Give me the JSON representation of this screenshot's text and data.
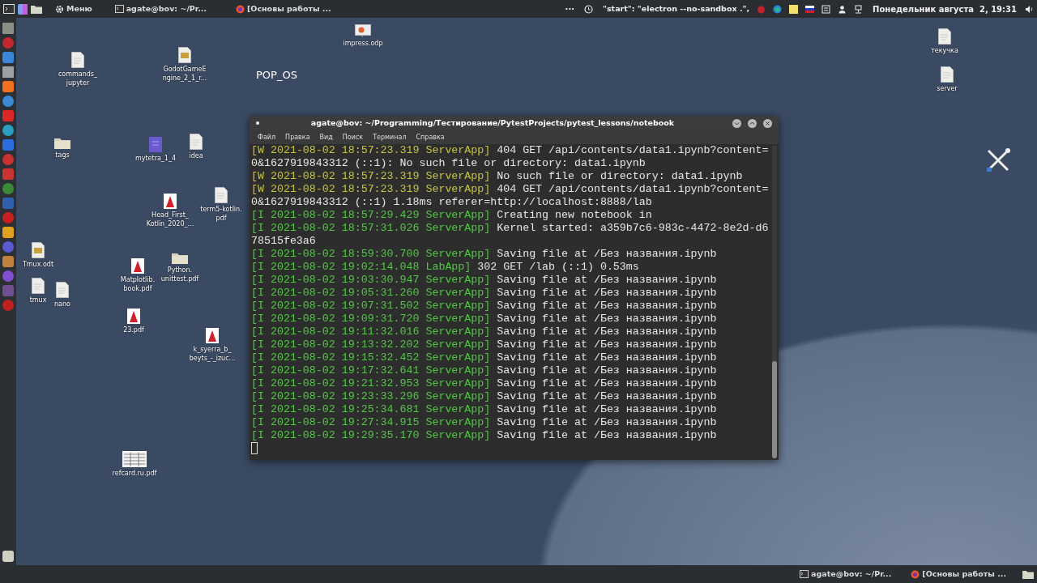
{
  "top_panel": {
    "menu_label": "Меню",
    "tasks": [
      {
        "kind": "terminal",
        "label": "agate@bov: ~/Pr..."
      },
      {
        "kind": "browser",
        "label": "[Основы работы ..."
      }
    ],
    "overflow": "···",
    "status_text": "\"start\": \"electron --no-sandbox .\",",
    "clock": "Понедельник августа  2, 19:31"
  },
  "desktop": {
    "os_label": "POP_OS",
    "icons": [
      {
        "kind": "doc",
        "label": [
          "commands_",
          "jupyter"
        ]
      },
      {
        "kind": "image",
        "label": [
          "GodotGameE",
          "ngine_2_1_r..."
        ]
      },
      {
        "kind": "slides",
        "label": [
          "impress.odp"
        ]
      },
      {
        "kind": "doc",
        "label": [
          "текучка"
        ]
      },
      {
        "kind": "doc",
        "label": [
          "server"
        ]
      },
      {
        "kind": "folder",
        "label": [
          "tags"
        ]
      },
      {
        "kind": "app",
        "label": [
          "mytetra_1_4"
        ]
      },
      {
        "kind": "doc",
        "label": [
          "idea"
        ]
      },
      {
        "kind": "pdf",
        "label": [
          "Head_First_",
          "Kotlin_2020_..."
        ]
      },
      {
        "kind": "doc",
        "label": [
          "term5-kotlin.",
          "pdf"
        ]
      },
      {
        "kind": "image",
        "label": [
          "Tmux.odt"
        ]
      },
      {
        "kind": "doc",
        "label": [
          "tmux"
        ]
      },
      {
        "kind": "doc",
        "label": [
          "nano"
        ]
      },
      {
        "kind": "pdf",
        "label": [
          "Matplotlib.",
          "book.pdf"
        ]
      },
      {
        "kind": "folder",
        "label": [
          "Python.",
          "unittest.pdf"
        ]
      },
      {
        "kind": "pdf",
        "label": [
          "23.pdf"
        ]
      },
      {
        "kind": "pdf",
        "label": [
          "k_syerra_b_",
          "beyts_-_izuc..."
        ]
      },
      {
        "kind": "table",
        "label": [
          "refcard.ru.pdf"
        ]
      }
    ]
  },
  "terminal": {
    "title": "agate@bov: ~/Programming/Тестирование/PytestProjects/pytest_lessons/notebook",
    "menu": [
      "Файл",
      "Правка",
      "Вид",
      "Поиск",
      "Терминал",
      "Справка"
    ],
    "lines": [
      {
        "kind": "warning",
        "prefix": "[W 2021-08-02 18:57:23.319 ServerApp]",
        "message": "404 GET /api/contents/data1.ipynb?content=0&1627919843312 (::1): No such file or directory: data1.ipynb"
      },
      {
        "kind": "warning",
        "prefix": "[W 2021-08-02 18:57:23.319 ServerApp]",
        "message": "No such file or directory: data1.ipynb"
      },
      {
        "kind": "warning",
        "prefix": "[W 2021-08-02 18:57:23.319 ServerApp]",
        "message": "404 GET /api/contents/data1.ipynb?content=0&1627919843312 (::1) 1.18ms referer=http://localhost:8888/lab"
      },
      {
        "kind": "info",
        "prefix": "[I 2021-08-02 18:57:29.429 ServerApp]",
        "message": "Creating new notebook in"
      },
      {
        "kind": "info",
        "prefix": "[I 2021-08-02 18:57:31.026 ServerApp]",
        "message": "Kernel started: a359b7c6-983c-4472-8e2d-d678515fe3a6"
      },
      {
        "kind": "info",
        "prefix": "[I 2021-08-02 18:59:30.700 ServerApp]",
        "message": "Saving file at /Без названия.ipynb"
      },
      {
        "kind": "info",
        "prefix": "[I 2021-08-02 19:02:14.048 LabApp]",
        "message": "302 GET /lab (::1) 0.53ms"
      },
      {
        "kind": "info",
        "prefix": "[I 2021-08-02 19:03:30.947 ServerApp]",
        "message": "Saving file at /Без названия.ipynb"
      },
      {
        "kind": "info",
        "prefix": "[I 2021-08-02 19:05:31.260 ServerApp]",
        "message": "Saving file at /Без названия.ipynb"
      },
      {
        "kind": "info",
        "prefix": "[I 2021-08-02 19:07:31.502 ServerApp]",
        "message": "Saving file at /Без названия.ipynb"
      },
      {
        "kind": "info",
        "prefix": "[I 2021-08-02 19:09:31.720 ServerApp]",
        "message": "Saving file at /Без названия.ipynb"
      },
      {
        "kind": "info",
        "prefix": "[I 2021-08-02 19:11:32.016 ServerApp]",
        "message": "Saving file at /Без названия.ipynb"
      },
      {
        "kind": "info",
        "prefix": "[I 2021-08-02 19:13:32.202 ServerApp]",
        "message": "Saving file at /Без названия.ipynb"
      },
      {
        "kind": "info",
        "prefix": "[I 2021-08-02 19:15:32.452 ServerApp]",
        "message": "Saving file at /Без названия.ipynb"
      },
      {
        "kind": "info",
        "prefix": "[I 2021-08-02 19:17:32.641 ServerApp]",
        "message": "Saving file at /Без названия.ipynb"
      },
      {
        "kind": "info",
        "prefix": "[I 2021-08-02 19:21:32.953 ServerApp]",
        "message": "Saving file at /Без названия.ipynb"
      },
      {
        "kind": "info",
        "prefix": "[I 2021-08-02 19:23:33.296 ServerApp]",
        "message": "Saving file at /Без названия.ipynb"
      },
      {
        "kind": "info",
        "prefix": "[I 2021-08-02 19:25:34.681 ServerApp]",
        "message": "Saving file at /Без названия.ipynb"
      },
      {
        "kind": "info",
        "prefix": "[I 2021-08-02 19:27:34.915 ServerApp]",
        "message": "Saving file at /Без названия.ipynb"
      },
      {
        "kind": "info",
        "prefix": "[I 2021-08-02 19:29:35.170 ServerApp]",
        "message": "Saving file at /Без названия.ipynb"
      }
    ]
  },
  "bottom_panel": {
    "tasks": [
      {
        "kind": "terminal",
        "label": "agate@bov: ~/Pr..."
      },
      {
        "kind": "browser",
        "label": "[Основы работы ..."
      }
    ]
  }
}
